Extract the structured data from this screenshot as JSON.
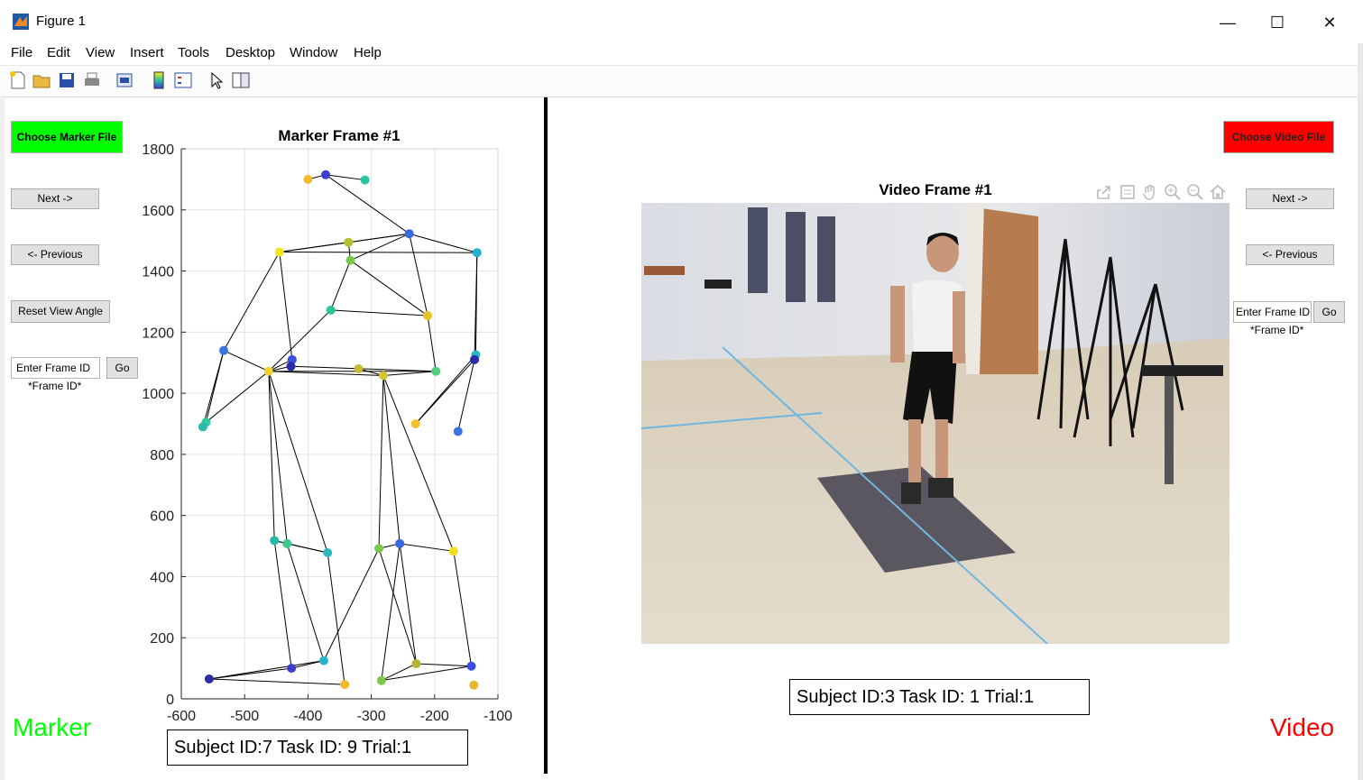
{
  "window": {
    "title": "Figure 1",
    "minimize": "—",
    "maximize": "☐",
    "close": "✕"
  },
  "menu": [
    "File",
    "Edit",
    "View",
    "Insert",
    "Tools",
    "Desktop",
    "Window",
    "Help"
  ],
  "toolbar": {
    "icons": [
      "new-figure-icon",
      "open-file-icon",
      "save-icon",
      "print-icon",
      "print-preview-icon",
      "colorbar-icon",
      "legend-icon",
      "pointer-icon",
      "property-inspector-icon"
    ]
  },
  "left_panel": {
    "choose_button": "Choose Marker File",
    "choose_color": "#00ff00",
    "next": "Next ->",
    "previous": "<- Previous",
    "reset_view": "Reset View Angle",
    "frame_input_value": "Enter Frame ID",
    "go": "Go",
    "frame_note": "*Frame ID*",
    "label": "Marker",
    "label_color": "#00ff00",
    "info": "Subject ID:7  Task ID: 9  Trial:1"
  },
  "right_panel": {
    "choose_button": "Choose Video File",
    "choose_color": "#ff0000",
    "next": "Next ->",
    "previous": "<- Previous",
    "frame_input_value": "Enter Frame ID",
    "go": "Go",
    "frame_note": "*Frame ID*",
    "label": "Video",
    "label_color": "#ff0000",
    "info": "Subject ID:3  Task ID: 1  Trial:1",
    "video_title": "Video Frame #1",
    "axes_icons": [
      "export-icon",
      "brush-icon",
      "pan-icon",
      "zoom-in-icon",
      "zoom-out-icon",
      "home-icon"
    ]
  },
  "chart_data": {
    "type": "scatter",
    "title": "Marker Frame #1",
    "xlabel": "",
    "ylabel": "",
    "xlim": [
      -600,
      -100
    ],
    "ylim": [
      0,
      1800
    ],
    "xticks": [
      -600,
      -500,
      -400,
      -300,
      -200,
      -100
    ],
    "yticks": [
      0,
      200,
      400,
      600,
      800,
      1000,
      1200,
      1400,
      1600,
      1800
    ],
    "grid": true,
    "points": [
      {
        "x": -400,
        "y": 1700,
        "c": "#f5b82e"
      },
      {
        "x": -372,
        "y": 1715,
        "c": "#3a3fd0"
      },
      {
        "x": -310,
        "y": 1698,
        "c": "#2ec4a0"
      },
      {
        "x": -240,
        "y": 1522,
        "c": "#3a66e0"
      },
      {
        "x": -336,
        "y": 1494,
        "c": "#b3bf2e"
      },
      {
        "x": -133,
        "y": 1460,
        "c": "#26b0d0"
      },
      {
        "x": -445,
        "y": 1462,
        "c": "#f5e51e"
      },
      {
        "x": -333,
        "y": 1435,
        "c": "#7cc84e"
      },
      {
        "x": -364,
        "y": 1272,
        "c": "#2ec49a"
      },
      {
        "x": -211,
        "y": 1254,
        "c": "#e6c52a"
      },
      {
        "x": -533,
        "y": 1140,
        "c": "#3a72e0"
      },
      {
        "x": -425,
        "y": 1110,
        "c": "#3a4fe0"
      },
      {
        "x": -427,
        "y": 1088,
        "c": "#2c2ca8"
      },
      {
        "x": -462,
        "y": 1072,
        "c": "#f3d22e"
      },
      {
        "x": -320,
        "y": 1080,
        "c": "#c8b832"
      },
      {
        "x": -281,
        "y": 1058,
        "c": "#d4c532"
      },
      {
        "x": -198,
        "y": 1072,
        "c": "#4fd07a"
      },
      {
        "x": -135,
        "y": 1126,
        "c": "#26b6c8"
      },
      {
        "x": -137,
        "y": 1110,
        "c": "#2c2ca8"
      },
      {
        "x": -561,
        "y": 905,
        "c": "#30c8a0"
      },
      {
        "x": -566,
        "y": 890,
        "c": "#2eb8a8"
      },
      {
        "x": -230,
        "y": 900,
        "c": "#f5c02e"
      },
      {
        "x": -163,
        "y": 875,
        "c": "#3a72e0"
      },
      {
        "x": -453,
        "y": 518,
        "c": "#28b8a8"
      },
      {
        "x": -433,
        "y": 508,
        "c": "#3ac88c"
      },
      {
        "x": -369,
        "y": 478,
        "c": "#30b8c0"
      },
      {
        "x": -288,
        "y": 492,
        "c": "#7cc84e"
      },
      {
        "x": -255,
        "y": 508,
        "c": "#3a66e0"
      },
      {
        "x": -170,
        "y": 483,
        "c": "#f0e022"
      },
      {
        "x": -375,
        "y": 125,
        "c": "#26b6c8"
      },
      {
        "x": -426,
        "y": 100,
        "c": "#3a3fd0"
      },
      {
        "x": -556,
        "y": 65,
        "c": "#2c2ca8"
      },
      {
        "x": -342,
        "y": 47,
        "c": "#f5b82e"
      },
      {
        "x": -229,
        "y": 115,
        "c": "#b3b62e"
      },
      {
        "x": -142,
        "y": 107,
        "c": "#3a4fe0"
      },
      {
        "x": -284,
        "y": 60,
        "c": "#7cc84e"
      },
      {
        "x": -138,
        "y": 45,
        "c": "#e8b82a"
      }
    ],
    "edges": [
      [
        0,
        1
      ],
      [
        1,
        2
      ],
      [
        1,
        3
      ],
      [
        3,
        4
      ],
      [
        3,
        5
      ],
      [
        3,
        6
      ],
      [
        3,
        7
      ],
      [
        6,
        4
      ],
      [
        6,
        5
      ],
      [
        6,
        10
      ],
      [
        6,
        11
      ],
      [
        4,
        7
      ],
      [
        7,
        8
      ],
      [
        7,
        9
      ],
      [
        8,
        9
      ],
      [
        8,
        13
      ],
      [
        3,
        9
      ],
      [
        9,
        16
      ],
      [
        5,
        17
      ],
      [
        5,
        18
      ],
      [
        10,
        13
      ],
      [
        10,
        19
      ],
      [
        10,
        20
      ],
      [
        11,
        13
      ],
      [
        13,
        15
      ],
      [
        13,
        16
      ],
      [
        14,
        15
      ],
      [
        12,
        13
      ],
      [
        12,
        16
      ],
      [
        13,
        19
      ],
      [
        13,
        23
      ],
      [
        13,
        25
      ],
      [
        13,
        24
      ],
      [
        15,
        26
      ],
      [
        15,
        28
      ],
      [
        15,
        27
      ],
      [
        15,
        16
      ],
      [
        17,
        21
      ],
      [
        18,
        21
      ],
      [
        18,
        22
      ],
      [
        23,
        25
      ],
      [
        23,
        24
      ],
      [
        24,
        25
      ],
      [
        23,
        30
      ],
      [
        24,
        29
      ],
      [
        25,
        32
      ],
      [
        29,
        30
      ],
      [
        30,
        31
      ],
      [
        29,
        31
      ],
      [
        31,
        32
      ],
      [
        26,
        27
      ],
      [
        27,
        28
      ],
      [
        26,
        29
      ],
      [
        26,
        33
      ],
      [
        27,
        33
      ],
      [
        28,
        34
      ],
      [
        27,
        35
      ],
      [
        33,
        34
      ],
      [
        33,
        35
      ],
      [
        34,
        35
      ]
    ]
  }
}
